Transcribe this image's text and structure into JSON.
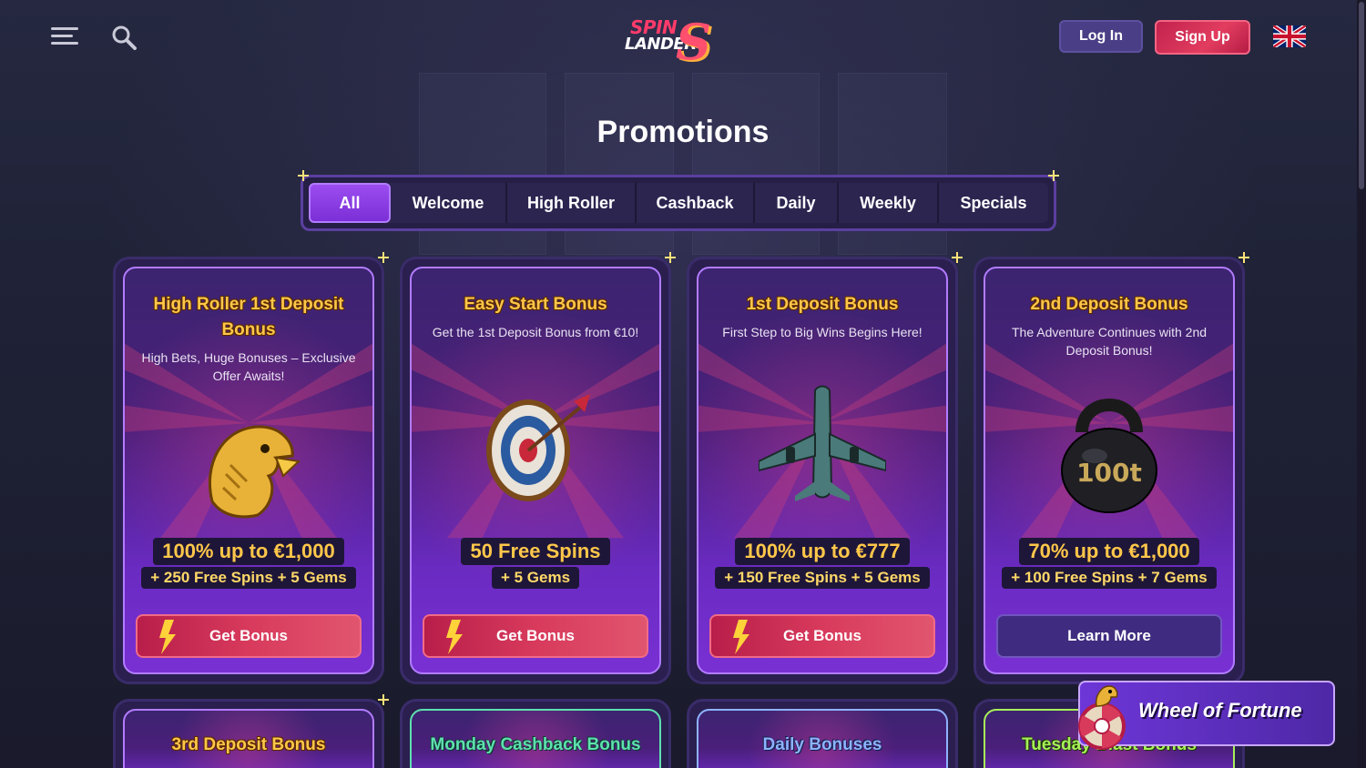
{
  "header": {
    "logo_line1": "SPIN",
    "logo_line2": "LANDER",
    "logo_mark": "S",
    "login_label": "Log In",
    "signup_label": "Sign Up",
    "language": "English (UK flag)"
  },
  "page_title": "Promotions",
  "tabs": [
    "All",
    "Welcome",
    "High Roller",
    "Cashback",
    "Daily",
    "Weekly",
    "Specials"
  ],
  "active_tab": "All",
  "cards": [
    {
      "title": "High Roller 1st Deposit Bonus",
      "desc": "High Bets, Huge Bonuses – Exclusive Offer Awaits!",
      "art": "eagle-icon",
      "offer_main": "100% up to €1,000",
      "offer_sub": "+ 250 Free Spins + 5 Gems",
      "button": "Get Bonus"
    },
    {
      "title": "Easy Start Bonus",
      "desc": "Get the 1st Deposit Bonus from €10!",
      "art": "target-icon",
      "offer_main": "50 Free Spins",
      "offer_sub": "+ 5 Gems",
      "button": "Get Bonus"
    },
    {
      "title": "1st Deposit Bonus",
      "desc": "First Step to Big Wins Begins Here!",
      "art": "airplane-icon",
      "offer_main": "100% up to €777",
      "offer_sub": "+ 150 Free Spins + 5 Gems",
      "button": "Get Bonus"
    },
    {
      "title": "2nd Deposit Bonus",
      "desc": "The Adventure Continues with 2nd Deposit Bonus!",
      "art": "kettlebell-icon",
      "art_text": "100t",
      "offer_main": "70% up to €1,000",
      "offer_sub": "+ 100 Free Spins + 7 Gems",
      "button": "Learn More"
    }
  ],
  "cards_row2": [
    {
      "title": "3rd Deposit Bonus",
      "color": "#ffc74a"
    },
    {
      "title": "Monday Cashback Bonus",
      "color": "#5fe0b0"
    },
    {
      "title": "Daily Bonuses",
      "color": "#8fb2ff"
    },
    {
      "title": "Tuesday Blast Bonus",
      "color": "#a8f05a"
    }
  ],
  "wheel_of_fortune": {
    "label": "Wheel of Fortune"
  },
  "colors": {
    "background": "#1c1b2e",
    "accent_purple": "#7b2fd6",
    "accent_red": "#d83a5c",
    "gold": "#ffc74a"
  }
}
